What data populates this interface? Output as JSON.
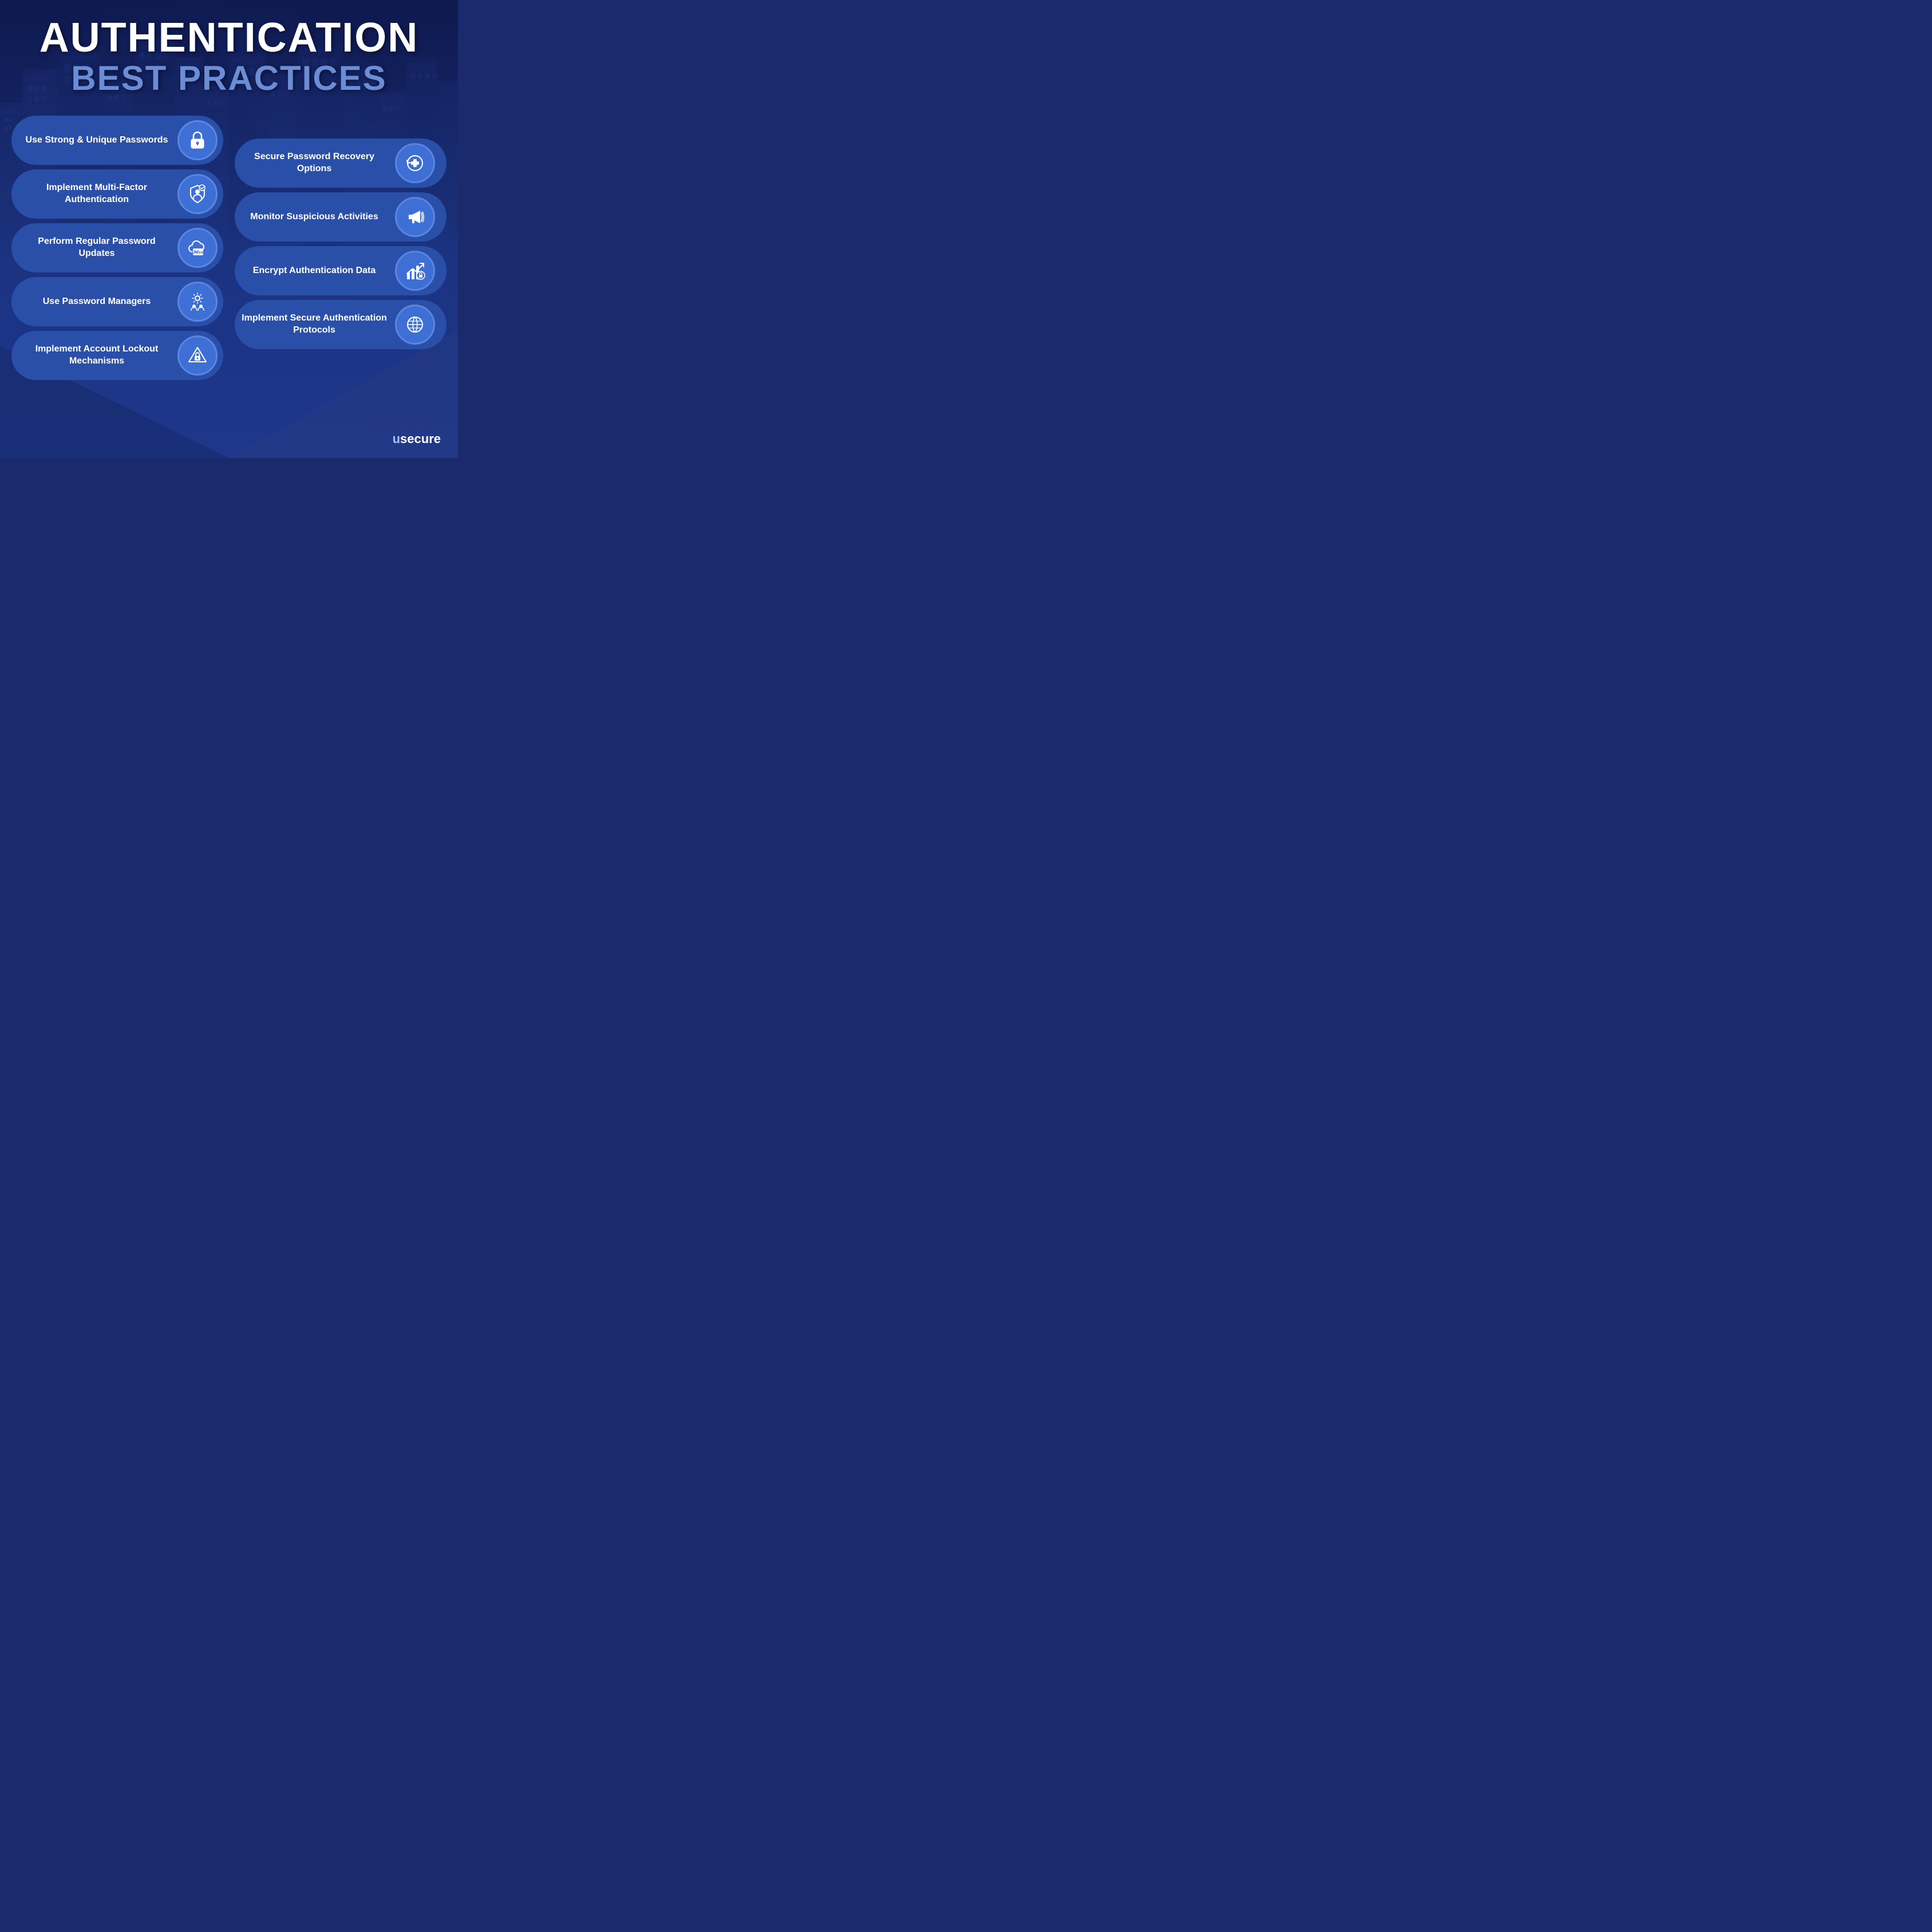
{
  "header": {
    "line1": "AUTHENTICATION",
    "line2": "BEST PRACTICES"
  },
  "left_items": [
    {
      "label": "Use Strong & Unique Passwords",
      "icon": "lock"
    },
    {
      "label": "Implement Multi-Factor Authentication",
      "icon": "shield-person"
    },
    {
      "label": "Perform Regular Password Updates",
      "icon": "cloud-update"
    },
    {
      "label": "Use Password Managers",
      "icon": "gear-people"
    },
    {
      "label": "Implement Account Lockout Mechanisms",
      "icon": "triangle-lock"
    }
  ],
  "right_items": [
    {
      "label": "Secure Password Recovery Options",
      "icon": "plus-circle-arrow"
    },
    {
      "label": "Monitor Suspicious Activities",
      "icon": "megaphone"
    },
    {
      "label": "Encrypt Authentication Data",
      "icon": "chart-lock"
    },
    {
      "label": "Implement Secure Authentication Protocols",
      "icon": "globe"
    }
  ],
  "brand": {
    "prefix": "u",
    "suffix": "secure"
  }
}
